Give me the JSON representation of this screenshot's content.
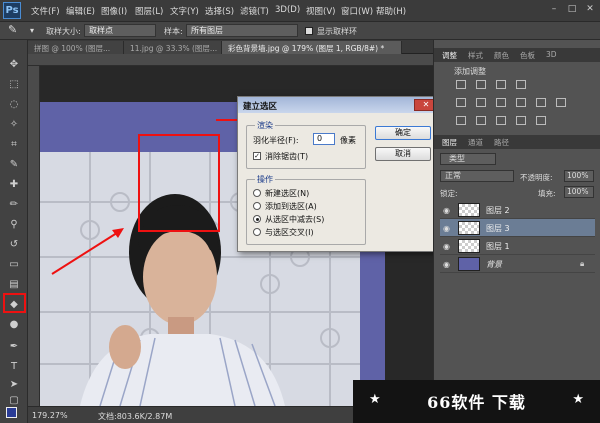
{
  "app": {
    "logo": "Ps"
  },
  "menu": [
    "文件(F)",
    "编辑(E)",
    "图像(I)",
    "图层(L)",
    "文字(Y)",
    "选择(S)",
    "滤镜(T)",
    "3D(D)",
    "视图(V)",
    "窗口(W)",
    "帮助(H)"
  ],
  "window_controls": [
    "–",
    "□",
    "✕"
  ],
  "options_bar": {
    "sample_size_label": "取样大小:",
    "sample_size_value": "取样点",
    "sample_label": "样本:",
    "sample_value": "所有图层",
    "show_ring_label": "显示取样环"
  },
  "tabs": [
    "拼图 @ 100% (图层...",
    "11.jpg @ 33.3% (图层...",
    "彩色背景墙.jpg @ 179% (图层 1, RGB/8#) *"
  ],
  "status": {
    "zoom": "179.27%",
    "doc": "文档:803.6K/2.87M"
  },
  "dialog": {
    "title": "建立选区",
    "render_group": "渲染",
    "feather_label": "羽化半径(F):",
    "feather_value": "0",
    "feather_unit": "像素",
    "antialias_label": "消除锯齿(T)",
    "operation_group": "操作",
    "options": [
      "新建选区(N)",
      "添加到选区(A)",
      "从选区中减去(S)",
      "与选区交叉(I)"
    ],
    "selected_option": 2,
    "ok": "确定",
    "cancel": "取消"
  },
  "panels": {
    "top_tabs": [
      "调整",
      "样式",
      "颜色",
      "色板",
      "3D"
    ],
    "adjust_label": "添加调整",
    "layer_tabs": [
      "图层",
      "通道",
      "路径"
    ],
    "kind_label": "类型",
    "blend_mode": "正常",
    "opacity_label": "不透明度:",
    "opacity_value": "100%",
    "lock_label": "锁定:",
    "fill_label": "填充:",
    "fill_value": "100%",
    "layers": [
      {
        "name": "图层 2",
        "selected": false,
        "italic": false
      },
      {
        "name": "图层 3",
        "selected": true,
        "italic": false
      },
      {
        "name": "图层 1",
        "selected": false,
        "italic": false
      },
      {
        "name": "背景",
        "selected": false,
        "italic": true
      }
    ]
  },
  "watermark": "66软件 下载",
  "colors": {
    "accent_red": "#e11111",
    "canvas_purple": "#5f62a7",
    "ps_bg": "#535353"
  }
}
